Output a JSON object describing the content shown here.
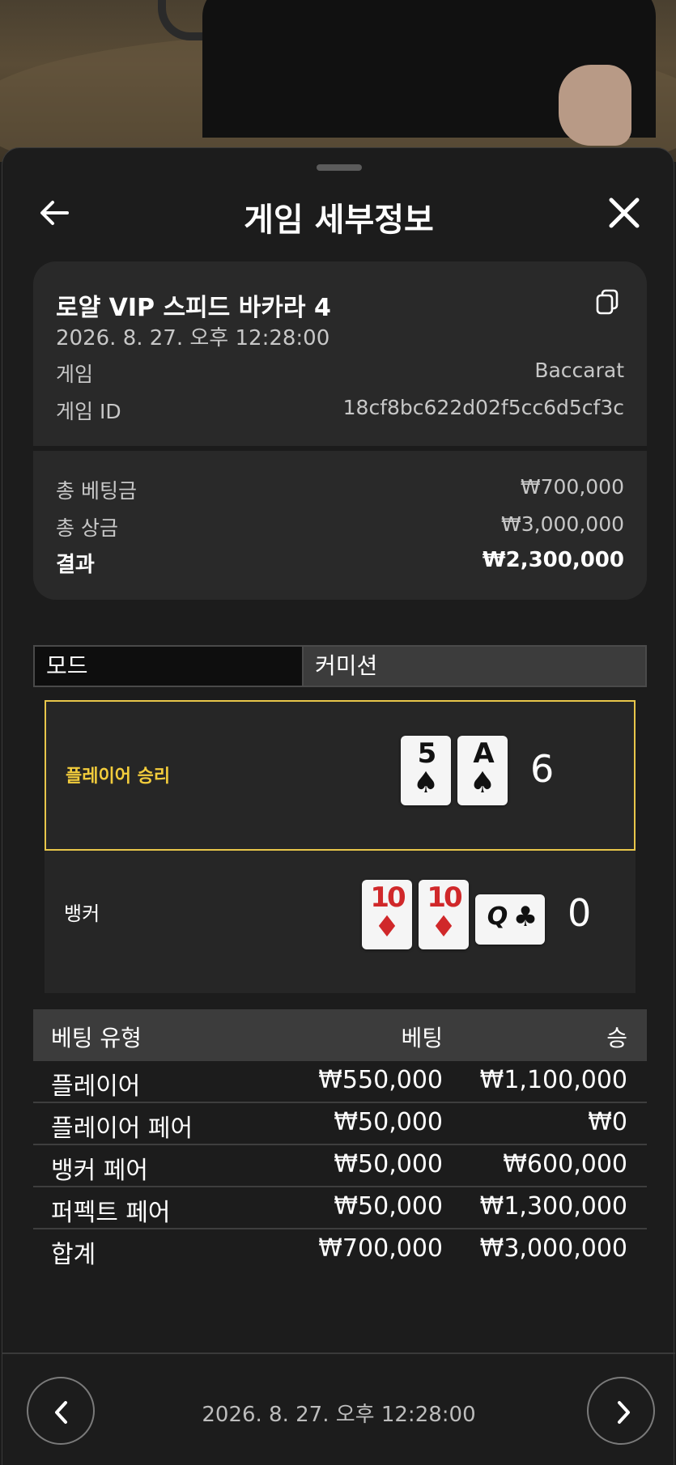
{
  "header": {
    "title": "게임 세부정보"
  },
  "card": {
    "game_name": "로얄 VIP 스피드 바카라 4",
    "date": "2026. 8. 27. 오후 12:28:00",
    "rows": [
      {
        "label": "게임",
        "value": "Baccarat"
      },
      {
        "label": "게임 ID",
        "value": "18cf8bc622d02f5cc6d5cf3c"
      }
    ],
    "totals": [
      {
        "label": "총 베팅금",
        "value": "₩700,000"
      },
      {
        "label": "총 상금",
        "value": "₩3,000,000"
      },
      {
        "label": "결과",
        "value": "₩2,300,000"
      }
    ]
  },
  "mode": {
    "label": "모드",
    "value": "커미션"
  },
  "results": {
    "player": {
      "label": "플레이어 승리",
      "score": "6",
      "cards": [
        {
          "rank": "5",
          "suit": "♠",
          "color": "black"
        },
        {
          "rank": "A",
          "suit": "♠",
          "color": "black"
        }
      ]
    },
    "banker": {
      "label": "뱅커",
      "score": "0",
      "cards": [
        {
          "rank": "10",
          "suit": "♦",
          "color": "red"
        },
        {
          "rank": "10",
          "suit": "♦",
          "color": "red"
        },
        {
          "rank": "Q",
          "suit": "♣",
          "color": "black",
          "sideways": true
        }
      ]
    }
  },
  "bets": {
    "headers": [
      "베팅 유형",
      "베팅",
      "승"
    ],
    "rows": [
      [
        "플레이어",
        "₩550,000",
        "₩1,100,000"
      ],
      [
        "플레이어 페어",
        "₩50,000",
        "₩0"
      ],
      [
        "뱅커 페어",
        "₩50,000",
        "₩600,000"
      ],
      [
        "퍼펙트 페어",
        "₩50,000",
        "₩1,300,000"
      ],
      [
        "합계",
        "₩700,000",
        "₩3,000,000"
      ]
    ]
  },
  "footer": {
    "date": "2026. 8. 27. 오후 12:28:00"
  },
  "colors": {
    "accent": "#e8c64a",
    "win_text": "#f2cc3c",
    "red_suit": "#d0282a"
  },
  "icons": [
    "back-arrow-icon",
    "close-icon",
    "copy-icon",
    "chevron-left-icon",
    "chevron-right-icon"
  ]
}
